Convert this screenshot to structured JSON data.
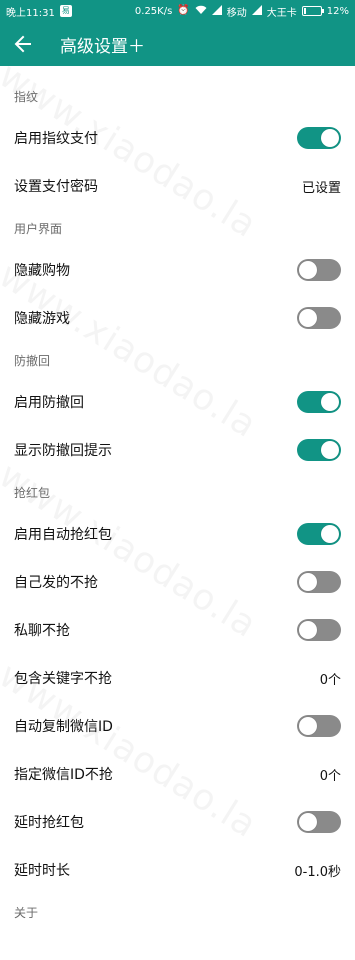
{
  "status_bar": {
    "time": "晚上11:31",
    "speed": "0.25K/s",
    "carrier1": "移动",
    "carrier2": "大王卡",
    "battery": "12%",
    "battery_level": 0.12,
    "badge": "易",
    "icons": [
      "alarm-icon",
      "wifi-icon",
      "signal-icon",
      "battery-icon"
    ]
  },
  "app_bar": {
    "title": "高级设置＋",
    "back_icon": "arrow-left-icon"
  },
  "watermark": "www.xiaodao.la",
  "colors": {
    "primary": "#119485",
    "toggle_off": "#8a8a8a",
    "section_text": "#6b6b6b"
  },
  "sections": {
    "fingerprint": {
      "header": "指纹",
      "enable_fingerprint_pay": {
        "label": "启用指纹支付",
        "on": true
      },
      "set_pay_password": {
        "label": "设置支付密码",
        "value": "已设置"
      }
    },
    "ui": {
      "header": "用户界面",
      "hide_shopping": {
        "label": "隐藏购物",
        "on": false
      },
      "hide_games": {
        "label": "隐藏游戏",
        "on": false
      }
    },
    "anti_recall": {
      "header": "防撤回",
      "enable_anti_recall": {
        "label": "启用防撤回",
        "on": true
      },
      "show_anti_recall_tip": {
        "label": "显示防撤回提示",
        "on": true
      }
    },
    "red_packet": {
      "header": "抢红包",
      "enable_auto_grab": {
        "label": "启用自动抢红包",
        "on": true
      },
      "skip_own": {
        "label": "自己发的不抢",
        "on": false
      },
      "skip_private": {
        "label": "私聊不抢",
        "on": false
      },
      "keyword_skip": {
        "label": "包含关键字不抢",
        "value": "0个"
      },
      "auto_copy_id": {
        "label": "自动复制微信ID",
        "on": false
      },
      "id_skip": {
        "label": "指定微信ID不抢",
        "value": "0个"
      },
      "delay_grab": {
        "label": "延时抢红包",
        "on": false
      },
      "delay_duration": {
        "label": "延时时长",
        "value": "0-1.0秒"
      }
    },
    "about": {
      "header": "关于"
    }
  }
}
